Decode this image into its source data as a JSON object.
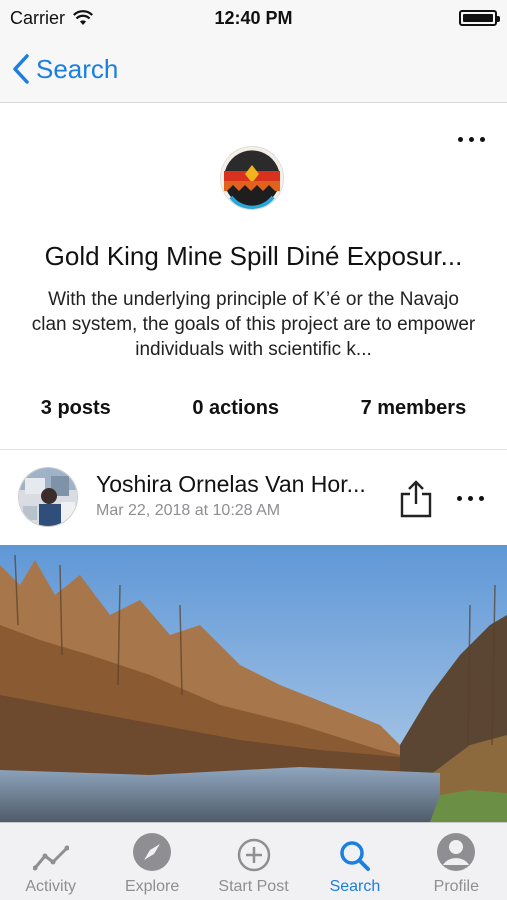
{
  "status": {
    "carrier": "Carrier",
    "time": "12:40 PM"
  },
  "nav": {
    "back_label": "Search"
  },
  "group": {
    "title": "Gold King Mine Spill Diné Exposur...",
    "description": "With the underlying principle of K’é or the Navajo clan system, the goals of this project are to empower individuals with scientific k...",
    "stats": {
      "posts": "3 posts",
      "actions": "0 actions",
      "members": "7 members"
    }
  },
  "post": {
    "author": "Yoshira Ornelas Van Hor...",
    "date": "Mar 22, 2018 at 10:28 AM"
  },
  "tabbar": {
    "items": [
      {
        "label": "Activity",
        "icon": "activity-icon"
      },
      {
        "label": "Explore",
        "icon": "compass-icon"
      },
      {
        "label": "Start Post",
        "icon": "plus-circle-icon"
      },
      {
        "label": "Search",
        "icon": "search-icon"
      },
      {
        "label": "Profile",
        "icon": "profile-icon"
      }
    ],
    "active": "Search"
  },
  "colors": {
    "accent": "#1a7fe0",
    "inactive": "#8e8e93",
    "bar_bg": "#f7f7f8"
  }
}
